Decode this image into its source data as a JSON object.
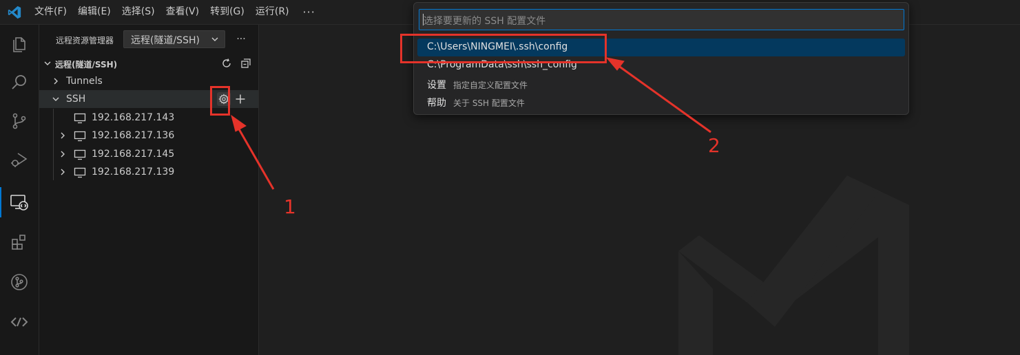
{
  "menu": {
    "items": [
      "文件(F)",
      "编辑(E)",
      "选择(S)",
      "查看(V)",
      "转到(G)",
      "运行(R)"
    ],
    "more": "···"
  },
  "activity_bar": {
    "items": [
      "files-icon",
      "search-icon",
      "source-control-icon",
      "run-debug-icon",
      "remote-explorer-icon",
      "extensions-icon",
      "git-graph-icon",
      "remote-connection-icon"
    ],
    "active": "remote-explorer-icon"
  },
  "sidebar": {
    "title": "远程资源管理器",
    "selector_value": "远程(隧道/SSH)",
    "more": "···",
    "section_title": "远程(隧道/SSH)",
    "tunnels_label": "Tunnels",
    "ssh_label": "SSH",
    "hosts": [
      "192.168.217.143",
      "192.168.217.136",
      "192.168.217.145",
      "192.168.217.139"
    ]
  },
  "quick_pick": {
    "placeholder": "选择要更新的 SSH 配置文件",
    "items": [
      {
        "label": "C:\\Users\\NINGMEI\\.ssh\\config",
        "description": ""
      },
      {
        "label": "C:\\ProgramData\\ssh\\ssh_config",
        "description": ""
      },
      {
        "label": "设置",
        "description": "指定自定义配置文件"
      },
      {
        "label": "帮助",
        "description": "关于 SSH 配置文件"
      }
    ]
  },
  "annotations": {
    "label_1": "1",
    "label_2": "2",
    "color": "#e5332a"
  },
  "colors": {
    "accent": "#0078d4",
    "selection": "#04395e"
  }
}
